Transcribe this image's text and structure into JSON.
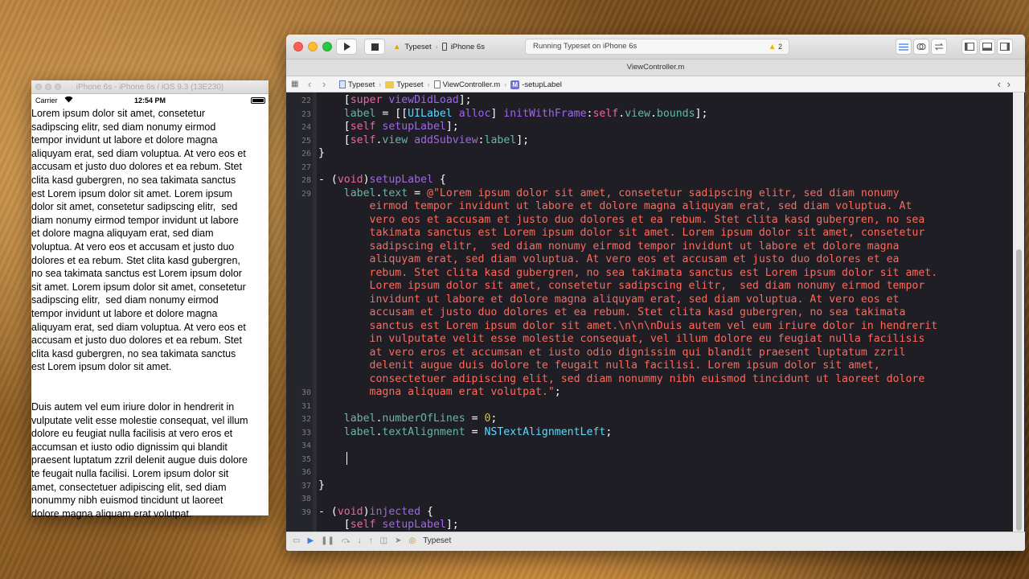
{
  "simulator": {
    "title": "iPhone 6s - iPhone 6s / iOS 9.3 (13E230)",
    "carrier": "Carrier",
    "time": "12:54 PM",
    "paragraphs": [
      "Lorem ipsum dolor sit amet, consetetur\nsadipscing elitr, sed diam nonumy eirmod\ntempor invidunt ut labore et dolore magna\naliquyam erat, sed diam voluptua. At vero eos et\naccusam et justo duo dolores et ea rebum. Stet\nclita kasd gubergren, no sea takimata sanctus\nest Lorem ipsum dolor sit amet. Lorem ipsum\ndolor sit amet, consetetur sadipscing elitr,  sed\ndiam nonumy eirmod tempor invidunt ut labore\net dolore magna aliquyam erat, sed diam\nvoluptua. At vero eos et accusam et justo duo\ndolores et ea rebum. Stet clita kasd gubergren,\nno sea takimata sanctus est Lorem ipsum dolor\nsit amet. Lorem ipsum dolor sit amet, consetetur\nsadipscing elitr,  sed diam nonumy eirmod\ntempor invidunt ut labore et dolore magna\naliquyam erat, sed diam voluptua. At vero eos et\naccusam et justo duo dolores et ea rebum. Stet\nclita kasd gubergren, no sea takimata sanctus\nest Lorem ipsum dolor sit amet.",
      "Duis autem vel eum iriure dolor in hendrerit in\nvulputate velit esse molestie consequat, vel illum\ndolore eu feugiat nulla facilisis at vero eros et\naccumsan et iusto odio dignissim qui blandit\npraesent luptatum zzril delenit augue duis dolore\nte feugait nulla facilisi. Lorem ipsum dolor sit\namet, consectetuer adipiscing elit, sed diam\nnonummy nibh euismod tincidunt ut laoreet\ndolore magna aliquam erat volutpat."
    ]
  },
  "xcode": {
    "scheme": "Typeset",
    "device": "iPhone 6s",
    "activity": "Running Typeset on iPhone 6s",
    "warnings": "2",
    "tab_title": "ViewController.m",
    "breadcrumbs": [
      "Typeset",
      "Typeset",
      "ViewController.m",
      "-setupLabel"
    ],
    "debug_target": "Typeset",
    "line_numbers": [
      "22",
      "23",
      "24",
      "25",
      "26",
      "27",
      "28",
      "29",
      "30",
      "31",
      "32",
      "33",
      "34",
      "35",
      "36",
      "37",
      "38",
      "39"
    ],
    "code_lines": [
      "    [super viewDidLoad];",
      "    label = [[UILabel alloc] initWithFrame:self.view.bounds];",
      "    [self setupLabel];",
      "    [self.view addSubview:label];",
      "}",
      "",
      "- (void)setupLabel {",
      "    label.text = @\"Lorem ipsum dolor sit amet, consetetur sadipscing elitr, sed diam nonumy",
      "        eirmod tempor invidunt ut labore et dolore magna aliquyam erat, sed diam voluptua. At",
      "        vero eos et accusam et justo duo dolores et ea rebum. Stet clita kasd gubergren, no sea",
      "        takimata sanctus est Lorem ipsum dolor sit amet. Lorem ipsum dolor sit amet, consetetur",
      "        sadipscing elitr,  sed diam nonumy eirmod tempor invidunt ut labore et dolore magna",
      "        aliquyam erat, sed diam voluptua. At vero eos et accusam et justo duo dolores et ea",
      "        rebum. Stet clita kasd gubergren, no sea takimata sanctus est Lorem ipsum dolor sit amet.",
      "        Lorem ipsum dolor sit amet, consetetur sadipscing elitr,  sed diam nonumy eirmod tempor",
      "        invidunt ut labore et dolore magna aliquyam erat, sed diam voluptua. At vero eos et",
      "        accusam et justo duo dolores et ea rebum. Stet clita kasd gubergren, no sea takimata",
      "        sanctus est Lorem ipsum dolor sit amet.\\n\\n\\nDuis autem vel eum iriure dolor in hendrerit",
      "        in vulputate velit esse molestie consequat, vel illum dolore eu feugiat nulla facilisis",
      "        at vero eros et accumsan et iusto odio dignissim qui blandit praesent luptatum zzril",
      "        delenit augue duis dolore te feugait nulla facilisi. Lorem ipsum dolor sit amet,",
      "        consectetuer adipiscing elit, sed diam nonummy nibh euismod tincidunt ut laoreet dolore",
      "        magna aliquam erat volutpat.\";",
      "",
      "    label.numberOfLines = 0;",
      "    label.textAlignment = NSTextAlignmentLeft;",
      "",
      "",
      "",
      "}",
      "",
      "- (void)injected {",
      "    [self setupLabel];"
    ]
  }
}
